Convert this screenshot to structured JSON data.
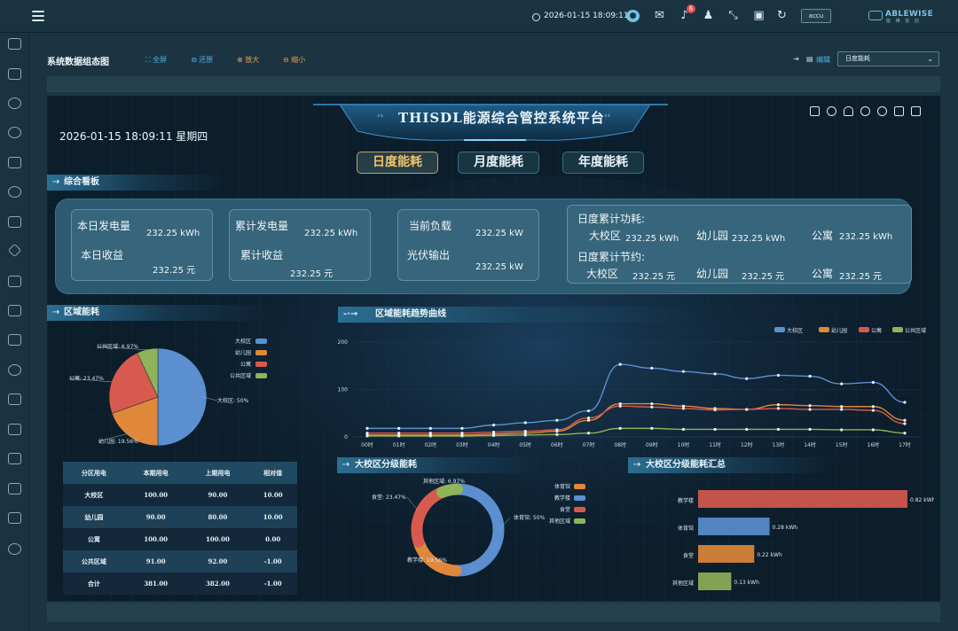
{
  "topbar": {
    "datetime": "2026-01-15 18:09:11",
    "notification_count": "6",
    "user": "accu",
    "logo_text": "ABLEWISE",
    "logo_sub": "能 维 信 创"
  },
  "toolbar": {
    "title": "系统数据组态图",
    "fullscreen": "全屏",
    "restore": "还原",
    "zoom_in": "放大",
    "zoom_out": "缩小",
    "edit": "编辑",
    "select_value": "日度能耗"
  },
  "dashboard": {
    "title": "THISDL能源综合管控系统平台",
    "datetime": "2026-01-15 18:09:11 星期四",
    "tabs": [
      "日度能耗",
      "月度能耗",
      "年度能耗"
    ],
    "active_tab": 0,
    "overview_title": "综合看板",
    "kpi": {
      "today_gen_label": "本日发电量",
      "today_gen_value": "232.25 kWh",
      "today_income_label": "本日收益",
      "today_income_value": "232.25 元",
      "total_gen_label": "累计发电量",
      "total_gen_value": "232.25 kWh",
      "total_income_label": "累计收益",
      "total_income_value": "232.25 元",
      "load_label": "当前负载",
      "load_value": "232.25 kW",
      "pv_label": "光伏输出",
      "pv_value": "232.25 kW",
      "daily_power_label": "日度累计功耗:",
      "daily_saving_label": "日度累计节约:",
      "power": [
        {
          "name": "大校区",
          "value": "232.25 kWh"
        },
        {
          "name": "幼儿园",
          "value": "232.25 kWh"
        },
        {
          "name": "公寓",
          "value": "232.25 kWh"
        }
      ],
      "saving": [
        {
          "name": "大校区",
          "value": "232.25 元"
        },
        {
          "name": "幼儿园",
          "value": "232.25 元"
        },
        {
          "name": "公寓",
          "value": "232.25 元"
        }
      ]
    },
    "region_title": "区域能耗",
    "trend_title": "区域能耗趋势曲线",
    "campus_title": "大校区分级能耗",
    "summary_title": "大校区分级能耗汇总",
    "table": {
      "headers": [
        "分区用电",
        "本期用电",
        "上期用电",
        "相对值"
      ],
      "rows": [
        [
          "大校区",
          "100.00",
          "90.00",
          "10.00"
        ],
        [
          "幼儿园",
          "90.00",
          "80.00",
          "10.00"
        ],
        [
          "公寓",
          "100.00",
          "100.00",
          "0.00"
        ],
        [
          "公共区域",
          "91.00",
          "92.00",
          "-1.00"
        ],
        [
          "合计",
          "381.00",
          "382.00",
          "-1.00"
        ]
      ]
    }
  },
  "colors": {
    "blue": "#5b8fd0",
    "orange": "#e0883a",
    "red": "#d85a4f",
    "green": "#8fb358",
    "accent": "#f2c36b"
  },
  "chart_data": [
    {
      "type": "pie",
      "categories": [
        "大校区",
        "幼儿园",
        "公寓",
        "公共区域"
      ],
      "values": [
        50,
        19.56,
        23.47,
        6.97
      ],
      "labels": [
        "大校区: 50%",
        "幼儿园: 19.56%",
        "公寓: 23.47%",
        "公共区域: 6.97%"
      ],
      "legend": "right"
    },
    {
      "type": "line",
      "x": [
        "00时",
        "01时",
        "02时",
        "03时",
        "04时",
        "05时",
        "06时",
        "07时",
        "08时",
        "09时",
        "10时",
        "11时",
        "12时",
        "13时",
        "14时",
        "15时",
        "16时",
        "17时"
      ],
      "ylim": [
        0,
        200
      ],
      "yticks": [
        "0",
        "100",
        "200"
      ],
      "legend": "top-right",
      "series": [
        {
          "name": "大校区",
          "values": [
            18,
            18,
            18,
            18,
            25,
            30,
            35,
            55,
            153,
            145,
            138,
            133,
            123,
            130,
            128,
            112,
            115,
            73
          ]
        },
        {
          "name": "幼儿园",
          "values": [
            4,
            4,
            4,
            4,
            6,
            8,
            12,
            35,
            70,
            70,
            65,
            60,
            58,
            68,
            66,
            64,
            64,
            35
          ]
        },
        {
          "name": "公寓",
          "values": [
            8,
            8,
            8,
            8,
            10,
            12,
            15,
            40,
            65,
            63,
            60,
            57,
            58,
            60,
            58,
            58,
            56,
            28
          ]
        },
        {
          "name": "公共区域",
          "values": [
            2,
            2,
            2,
            2,
            3,
            4,
            5,
            8,
            18,
            18,
            16,
            16,
            16,
            16,
            16,
            15,
            15,
            8
          ]
        }
      ]
    },
    {
      "type": "pie",
      "categories": [
        "体育馆",
        "教学楼",
        "食堂",
        "其他区域"
      ],
      "values": [
        50,
        19.56,
        23.47,
        6.97
      ],
      "labels": [
        "体育馆: 50%",
        "教学楼: 19.56%",
        "食堂: 23.47%",
        "其他区域: 6.97%"
      ],
      "legend_order": [
        "体育馆",
        "教学楼",
        "食堂",
        "其他区域"
      ],
      "legend": "right"
    },
    {
      "type": "bar",
      "orientation": "horizontal",
      "categories": [
        "教学楼",
        "体育馆",
        "食堂",
        "其他区域"
      ],
      "values": [
        0.82,
        0.28,
        0.22,
        0.13
      ],
      "labels": [
        "0.82 kWh",
        "0.28 kWh",
        "0.22 kWh",
        "0.13 kWh"
      ]
    }
  ]
}
